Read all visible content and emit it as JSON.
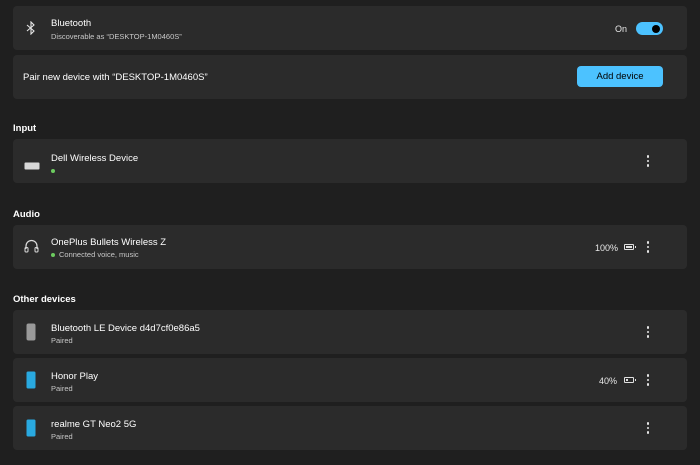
{
  "bluetooth": {
    "icon": "bluetooth-icon",
    "title": "Bluetooth",
    "subtitle": "Discoverable as “DESKTOP-1M0460S”",
    "state_label": "On",
    "enabled": true,
    "accent": "#4cc2ff"
  },
  "pair": {
    "label": "Pair new device with “DESKTOP-1M0460S”",
    "button_label": "Add device"
  },
  "sections": {
    "input": "Input",
    "audio": "Audio",
    "other": "Other devices"
  },
  "input_devices": [
    {
      "icon": "keyboard-icon",
      "name": "Dell Wireless Device",
      "status": "",
      "status_color": "#6ccb5f"
    }
  ],
  "audio_devices": [
    {
      "icon": "headphones-icon",
      "name": "OnePlus Bullets Wireless Z",
      "status": "Connected voice, music",
      "battery": "100%",
      "battery_level": 1.0
    }
  ],
  "other_devices": [
    {
      "icon": "speaker-device-icon",
      "name": "Bluetooth LE Device d4d7cf0e86a5",
      "status": "Paired"
    },
    {
      "icon": "phone-icon",
      "name": "Honor Play",
      "status": "Paired",
      "battery": "40%",
      "battery_level": 0.4
    },
    {
      "icon": "phone-icon",
      "name": "realme GT Neo2 5G",
      "status": "Paired"
    }
  ]
}
